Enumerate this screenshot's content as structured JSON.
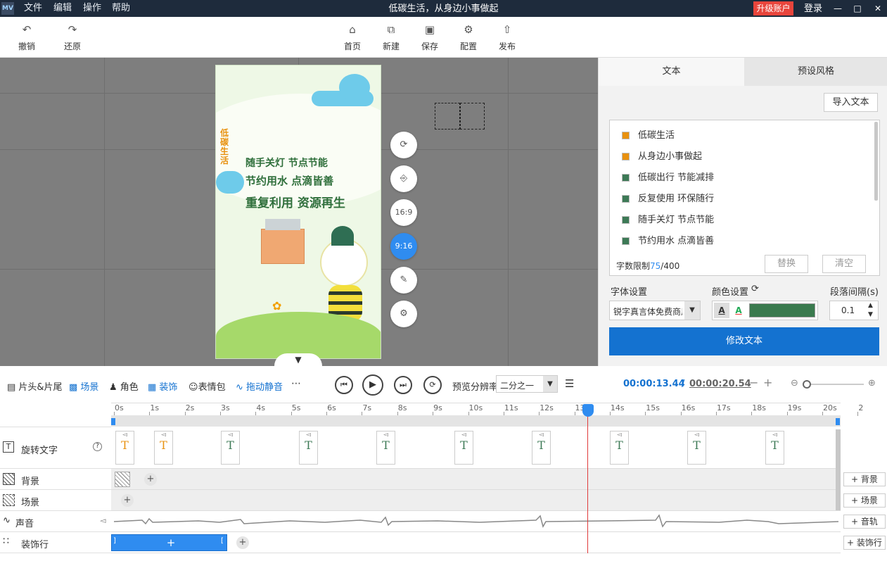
{
  "titlebar": {
    "logo": "MV",
    "menu": [
      "文件",
      "编辑",
      "操作",
      "帮助"
    ],
    "title": "低碳生活，从身边小事做起",
    "upgrade": "升级账户",
    "login": "登录"
  },
  "toolbar": {
    "undo": "撤销",
    "redo": "还原",
    "home": "首页",
    "new": "新建",
    "save": "保存",
    "config": "配置",
    "publish": "发布"
  },
  "poster": {
    "vertical_title": "低碳生活",
    "lines": [
      "随手关灯 节点节能",
      "节约用水 点滴皆善",
      "重复利用 资源再生"
    ]
  },
  "canvas_buttons": {
    "ratio_169": "16:9",
    "ratio_916": "9:16"
  },
  "right_panel": {
    "tabs": [
      "文本",
      "预设风格"
    ],
    "import_text": "导入文本",
    "items": [
      {
        "text": "低碳生活",
        "color": "#e8910f"
      },
      {
        "text": "从身边小事做起",
        "color": "#e8910f"
      },
      {
        "text": "低碳出行 节能减排",
        "color": "#3d7a56"
      },
      {
        "text": "反复使用 环保随行",
        "color": "#3d7a56"
      },
      {
        "text": "随手关灯 节点节能",
        "color": "#3d7a56"
      },
      {
        "text": "节约用水 点滴皆善",
        "color": "#3d7a56"
      }
    ],
    "char_limit_label": "字数限制",
    "char_count": "75",
    "char_max": "/400",
    "replace": "替换",
    "clear": "清空",
    "font_label": "字体设置",
    "font_value": "锐字真言体免费商用",
    "color_label": "颜色设置",
    "spacing_label": "段落间隔(s)",
    "spacing_value": "0.1",
    "font_color": "#3a7a4e",
    "modify": "修改文本"
  },
  "timeline_bar": {
    "head_tail": "片头&片尾",
    "scene": "场景",
    "role": "角色",
    "decor": "装饰",
    "emoji": "表情包",
    "mute": "拖动静音",
    "resolution_label": "预览分辨率",
    "resolution_value": "二分之一",
    "current_time": "00:00:13.44",
    "separator": "/",
    "total_time": "00:00:20.54"
  },
  "ruler": [
    "0s",
    "1s",
    "2s",
    "3s",
    "4s",
    "5s",
    "6s",
    "7s",
    "8s",
    "9s",
    "10s",
    "11s",
    "12s",
    "13s",
    "14s",
    "15s",
    "16s",
    "17s",
    "18s",
    "19s",
    "20s",
    "2"
  ],
  "tracks": {
    "rotate_text": "旋转文字",
    "background": "背景",
    "scene": "场景",
    "sound": "声音",
    "decor_row": "装饰行"
  },
  "add_buttons": {
    "background": "背景",
    "scene": "场景",
    "audio": "音轨",
    "decor": "装饰行"
  }
}
